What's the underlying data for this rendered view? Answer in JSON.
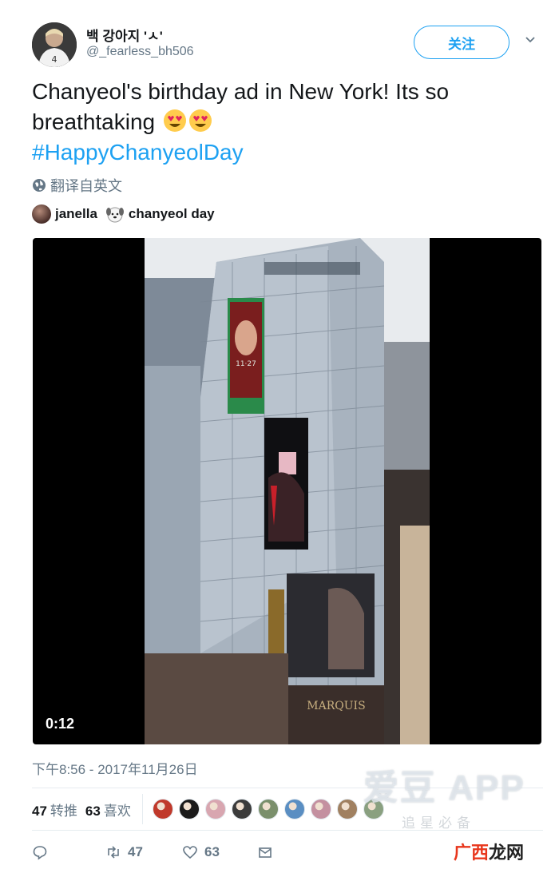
{
  "user": {
    "display_name": "백 강아지 'ㅅ'",
    "handle": "@_fearless_bh506",
    "follow_label": "关注"
  },
  "tweet": {
    "text": "Chanyeol's birthday ad in New York! Its so breathtaking",
    "hashtag": "#HappyChanyeolDay",
    "translate_label": "翻译自英文"
  },
  "tagged": [
    {
      "name": "janella",
      "icon": "user-avatar"
    },
    {
      "name": "chanyeol day",
      "icon": "dog-emoji-avatar"
    }
  ],
  "video": {
    "elapsed": "0:12"
  },
  "timestamp": "下午8:56 - 2017年11月26日",
  "stats": {
    "retweets_count": "47",
    "retweets_label": "转推",
    "likes_count": "63",
    "likes_label": "喜欢",
    "liker_colors": [
      "#c0392b",
      "#1a1a1a",
      "#d8a6b0",
      "#3b3b3b",
      "#7a8f6b",
      "#5a8ec2",
      "#c490a0",
      "#a08060",
      "#8aa080"
    ]
  },
  "actions": {
    "reply_icon": "reply-icon",
    "retweet_count": "47",
    "like_count": "63",
    "dm_icon": "envelope-icon"
  },
  "watermark": {
    "main": "爱豆 APP",
    "sub": "追星必备"
  },
  "site_logo": {
    "part1": "广西",
    "part2": "龙网"
  },
  "colors": {
    "accent": "#1da1f2",
    "text": "#14171a",
    "secondary": "#657786"
  }
}
